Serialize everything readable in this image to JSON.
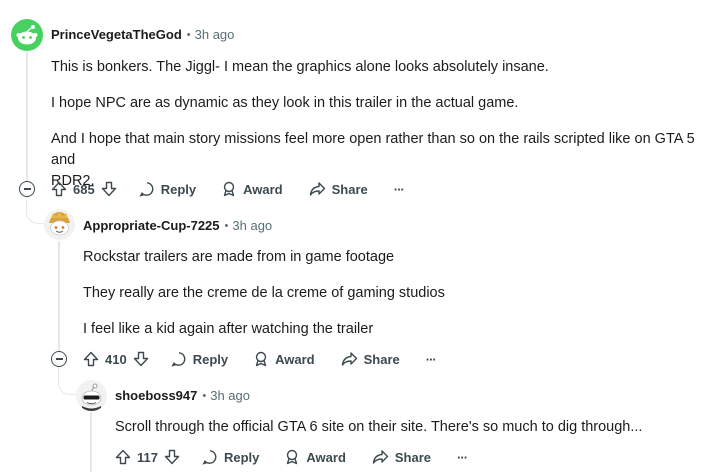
{
  "comments": [
    {
      "username": "PrinceVegetaTheGod",
      "time": "3h ago",
      "paragraphs": [
        "This is bonkers. The Jiggl- I mean the graphics alone looks absolutely insane.",
        "I hope NPC are as dynamic as they look in this trailer in the actual game.",
        "And I hope that main story missions feel more open rather than so on the rails scripted like on GTA 5 and",
        "RDR2."
      ],
      "votes": "685",
      "reply_label": "Reply",
      "award_label": "Award",
      "share_label": "Share",
      "avatar_color": "#46d160"
    },
    {
      "username": "Appropriate-Cup-7225",
      "time": "3h ago",
      "paragraphs": [
        "Rockstar trailers are made from in game footage",
        "They really are the creme de la creme of gaming studios",
        "I feel like a kid again after watching the trailer"
      ],
      "votes": "410",
      "reply_label": "Reply",
      "award_label": "Award",
      "share_label": "Share"
    },
    {
      "username": "shoeboss947",
      "time": "3h ago",
      "paragraphs": [
        "Scroll through the official GTA 6 site on their site. There's so much to dig through..."
      ],
      "votes": "117",
      "reply_label": "Reply",
      "award_label": "Award",
      "share_label": "Share"
    }
  ],
  "separator": "•",
  "more_label": "···"
}
